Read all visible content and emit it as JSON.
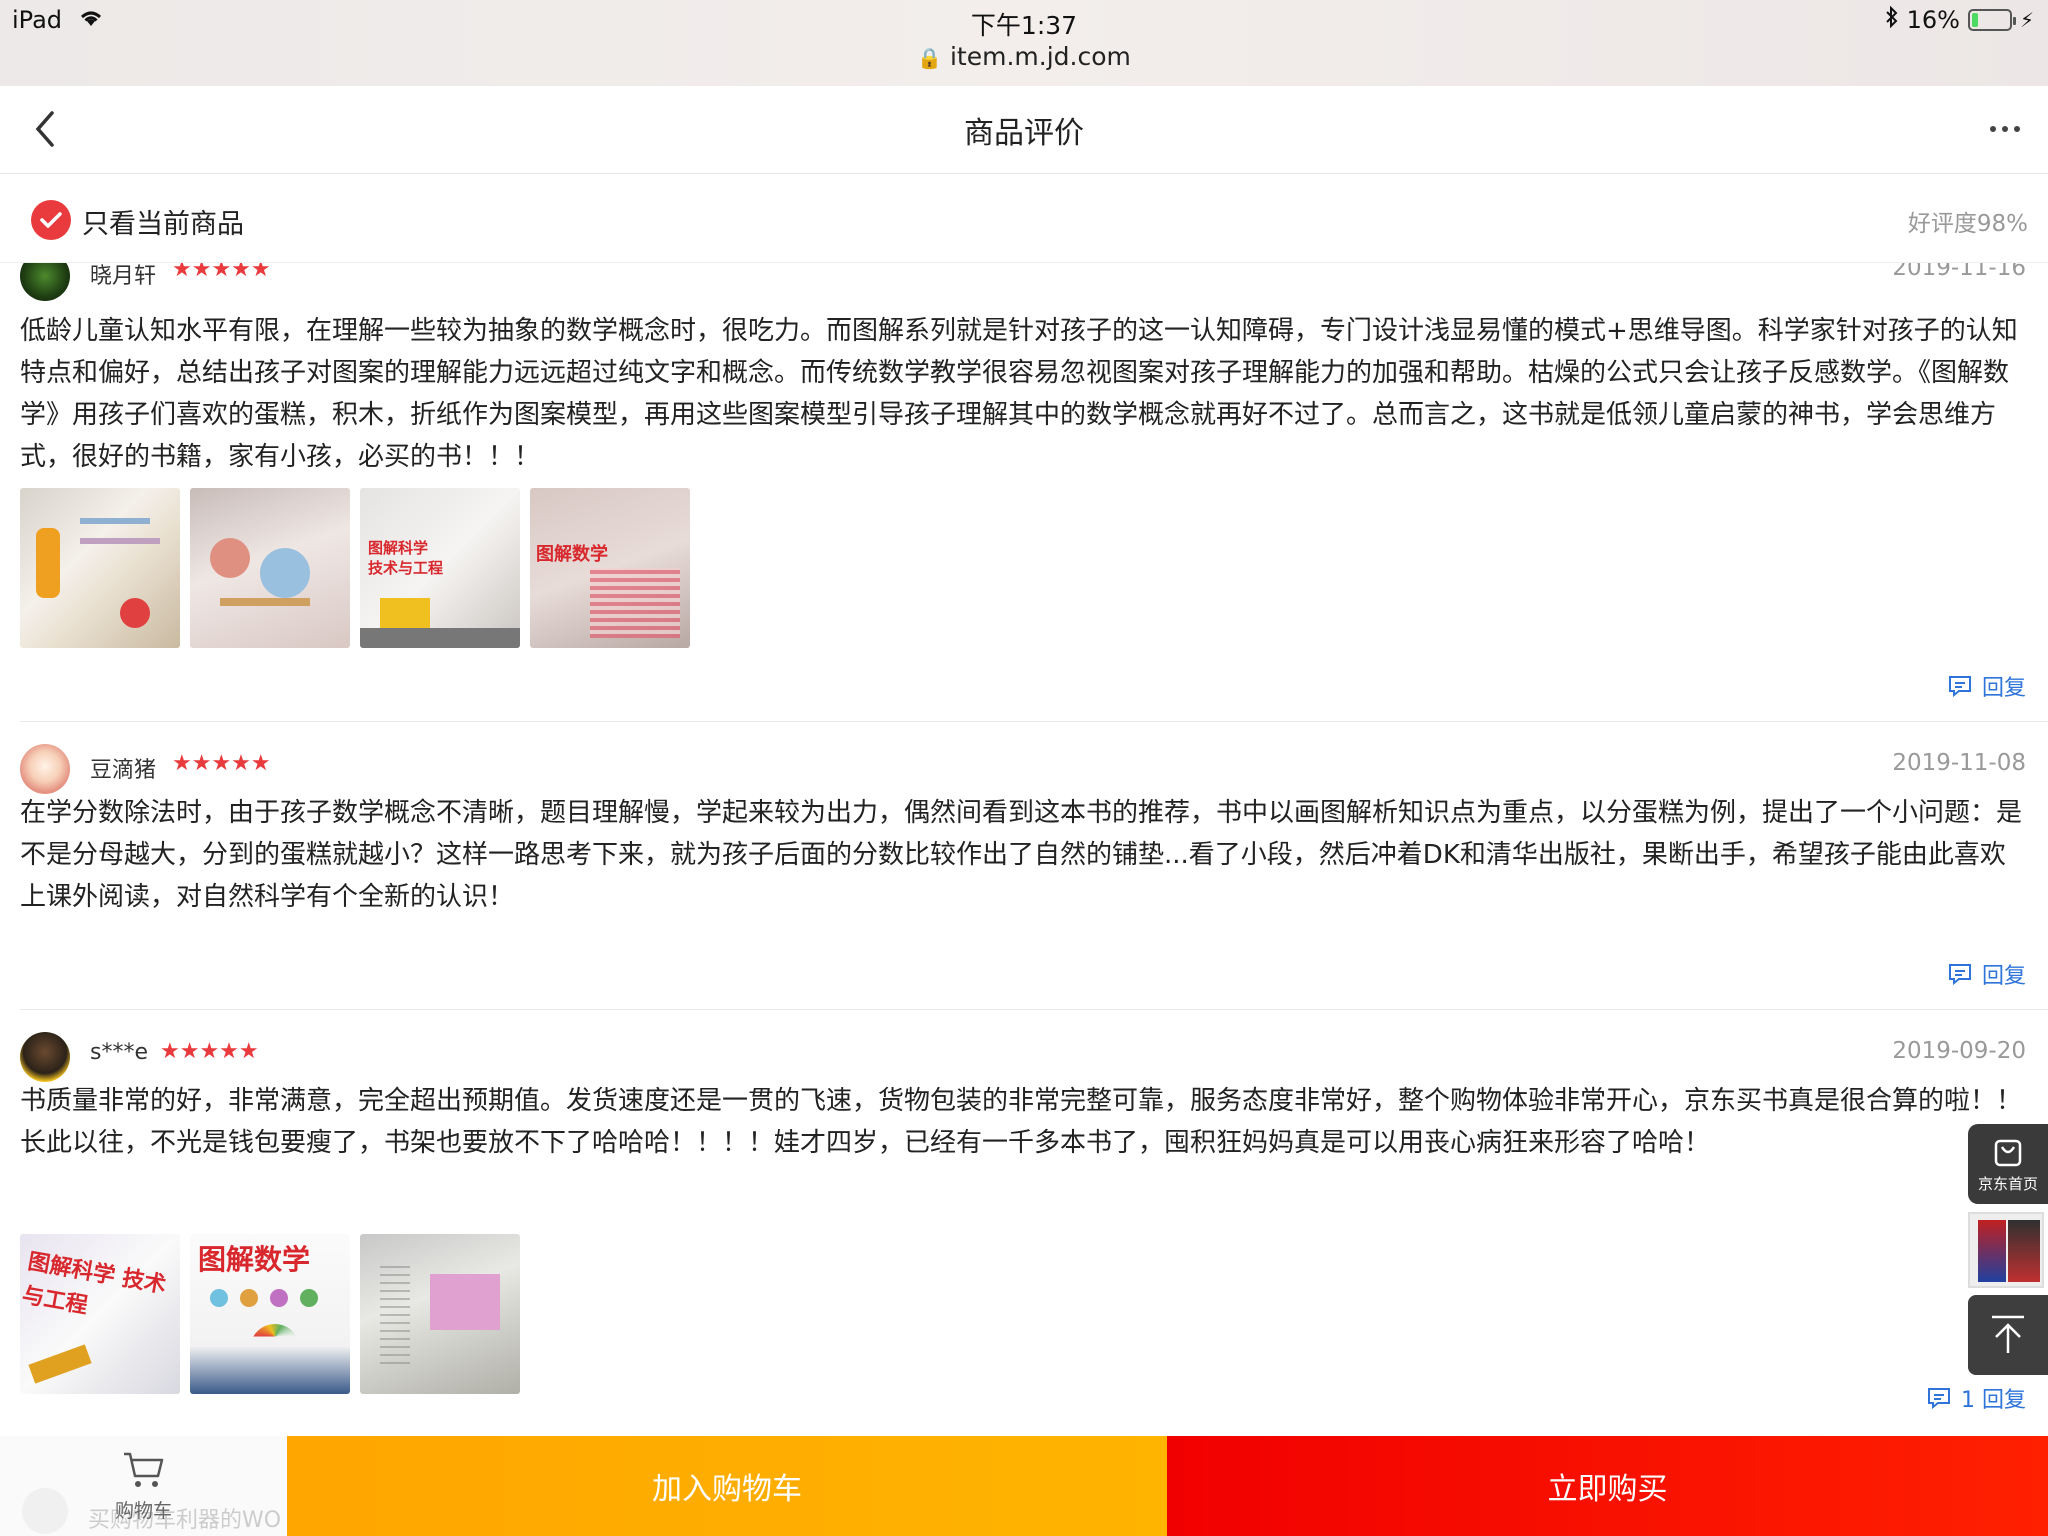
{
  "status_bar": {
    "device": "iPad",
    "time": "下午1:37",
    "url": "item.m.jd.com",
    "battery": "16%",
    "battery_level": 0.16
  },
  "header": {
    "title": "商品评价"
  },
  "filter": {
    "label": "只看当前商品",
    "good_rate": "好评度98%"
  },
  "reviews": [
    {
      "user": "晓月轩",
      "date": "2019-11-16",
      "stars": 5,
      "text": "低龄儿童认知水平有限，在理解一些较为抽象的数学概念时，很吃力。而图解系列就是针对孩子的这一认知障碍，专门设计浅显易懂的模式+思维导图。科学家针对孩子的认知特点和偏好，总结出孩子对图案的理解能力远远超过纯文字和概念。而传统数学教学很容易忽视图案对孩子理解能力的加强和帮助。枯燥的公式只会让孩子反感数学。《图解数学》用孩子们喜欢的蛋糕，积木，折纸作为图案模型，再用这些图案模型引导孩子理解其中的数学概念就再好不过了。总而言之，这书就是低领儿童启蒙的神书，学会思维方式，很好的书籍，家有小孩，必买的书！！！",
      "reply": "回复",
      "photo_titles": [
        "",
        "",
        "图解科学 技术与工程",
        "图解数学"
      ]
    },
    {
      "user": "豆滴猪",
      "date": "2019-11-08",
      "stars": 5,
      "text": "在学分数除法时，由于孩子数学概念不清晰，题目理解慢，学起来较为出力，偶然间看到这本书的推荐，书中以画图解析知识点为重点，以分蛋糕为例，提出了一个小问题：是不是分母越大，分到的蛋糕就越小？这样一路思考下来，就为孩子后面的分数比较作出了自然的铺垫...看了小段，然后冲着DK和清华出版社，果断出手，希望孩子能由此喜欢上课外阅读，对自然科学有个全新的认识！",
      "reply": "回复"
    },
    {
      "user": "s***e",
      "date": "2019-09-20",
      "stars": 5,
      "text": "书质量非常的好，非常满意，完全超出预期值。发货速度还是一贯的飞速，货物包装的非常完整可靠，服务态度非常好，整个购物体验非常开心，京东买书真是很合算的啦！！长此以往，不光是钱包要瘦了，书架也要放不下了哈哈哈！！！！娃才四岁，已经有一千多本书了，囤积狂妈妈真是可以用丧心病狂来形容了哈哈！",
      "reply": "1 回复",
      "photo_titles": [
        "图解科学 技术与工程",
        "图解数学",
        ""
      ]
    }
  ],
  "next_review_partial": "买购物车利器的WO",
  "float": {
    "home_label": "京东首页"
  },
  "bottom": {
    "cart_label": "购物车",
    "add_to_cart": "加入购物车",
    "buy_now": "立即购买"
  },
  "colors": {
    "accent_red": "#e93b3d",
    "link_blue": "#2e74d9",
    "orange": "#ffa600",
    "buy_red": "#f10000"
  }
}
